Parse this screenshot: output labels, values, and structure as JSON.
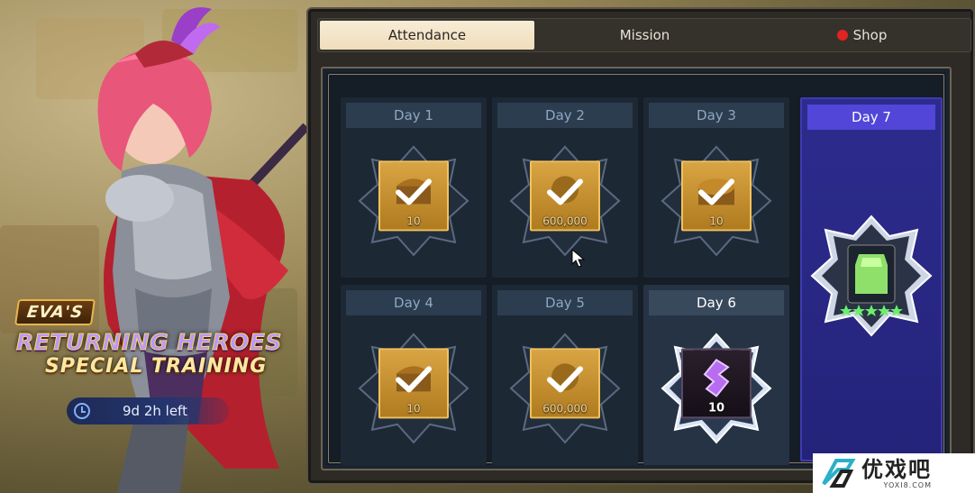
{
  "tabs": [
    {
      "label": "Attendance",
      "active": true
    },
    {
      "label": "Mission",
      "active": false
    },
    {
      "label": "Shop",
      "active": false,
      "has_notification": true
    }
  ],
  "event": {
    "owner": "EVA'S",
    "title": "RETURNING HEROES",
    "subtitle": "SPECIAL TRAINING",
    "time_left": "9d 2h left"
  },
  "days": [
    {
      "label": "Day 1",
      "quantity": "10",
      "claimed": true,
      "item": "chest-icon"
    },
    {
      "label": "Day 2",
      "quantity": "600,000",
      "claimed": true,
      "item": "gold-icon"
    },
    {
      "label": "Day 3",
      "quantity": "10",
      "claimed": true,
      "item": "treasure-icon"
    },
    {
      "label": "Day 4",
      "quantity": "10",
      "claimed": true,
      "item": "chest-icon"
    },
    {
      "label": "Day 5",
      "quantity": "600,000",
      "claimed": true,
      "item": "gold-icon"
    },
    {
      "label": "Day 6",
      "quantity": "10",
      "claimed": false,
      "today": true,
      "item": "crystal-icon"
    },
    {
      "label": "Day 7",
      "quantity": "",
      "claimed": false,
      "stars": 5,
      "item": "hero-card-icon"
    }
  ],
  "watermark": {
    "name": "优戏吧",
    "url": "YOXI8.COM"
  },
  "colors": {
    "accent_gold": "#d9a443",
    "day7_bg": "#2d2c8e",
    "day7_header": "#5146d8",
    "notification": "#e32222"
  }
}
